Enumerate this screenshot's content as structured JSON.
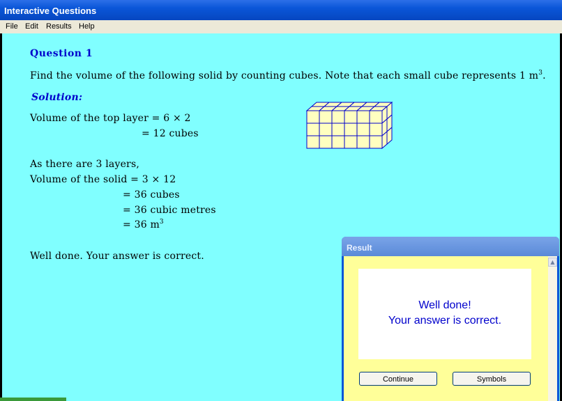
{
  "window": {
    "title": "Interactive Questions"
  },
  "menu": [
    "File",
    "Edit",
    "Results",
    "Help"
  ],
  "question": {
    "heading": "Question 1",
    "prompt": "Find the volume of the following solid by counting cubes.  Note that each small cube represents 1 m",
    "prompt_sup": "3",
    "prompt_end": "."
  },
  "solution": {
    "heading": "Solution:",
    "line1": "Volume of the top layer = 6 × 2",
    "line2": "= 12 cubes",
    "line3": "As there are 3 layers,",
    "line4": "Volume of the solid = 3 × 12",
    "line5": "= 36 cubes",
    "line6": "= 36 cubic metres",
    "line7": "= 36 m",
    "line7_sup": "3",
    "feedback": "Well done.  Your answer is correct."
  },
  "figure": {
    "columns": 6,
    "depth": 2,
    "layers": 3,
    "face_color": "#ffffc0",
    "edge_color": "#0000cc"
  },
  "dialog": {
    "title": "Result",
    "message_line1": "Well done!",
    "message_line2": "Your answer is correct.",
    "continue_label": "Continue",
    "symbols_label": "Symbols",
    "scroll_up": "▲"
  },
  "colors": {
    "background": "#80ffff",
    "accent": "#0000cc",
    "dialog_body": "#ffff99"
  }
}
